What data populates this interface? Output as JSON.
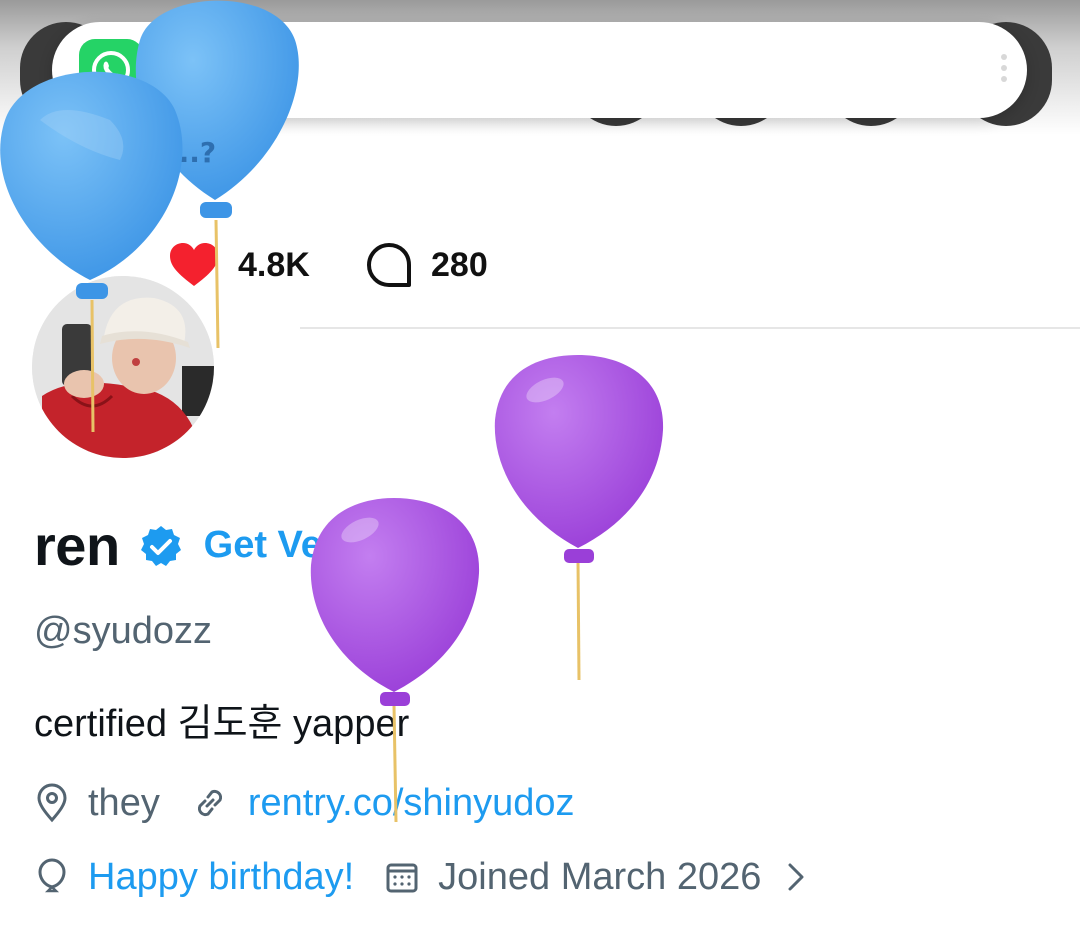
{
  "notification": {
    "app_icon": "whatsapp-icon",
    "text": ""
  },
  "stats": {
    "likes": "4.8K",
    "replies": "280",
    "like_icon": "heart-icon",
    "reply_icon": "speech-bubble-icon"
  },
  "profile": {
    "name": "ren",
    "verified_icon": "verified-badge-icon",
    "get_verified": "Get Verified",
    "handle": "@syudozz",
    "bio": "certified 김도훈 yapper",
    "location": "they",
    "website": "rentry.co/shinyudoz",
    "birthday": "Happy birthday!",
    "joined": "Joined March 2026"
  },
  "balloon_label": "...?",
  "colors": {
    "accent": "#1d9bf0",
    "like": "#f4212e",
    "balloon_blue": "#4aa3ee",
    "balloon_purple": "#a64ddc",
    "whatsapp": "#25d366"
  }
}
